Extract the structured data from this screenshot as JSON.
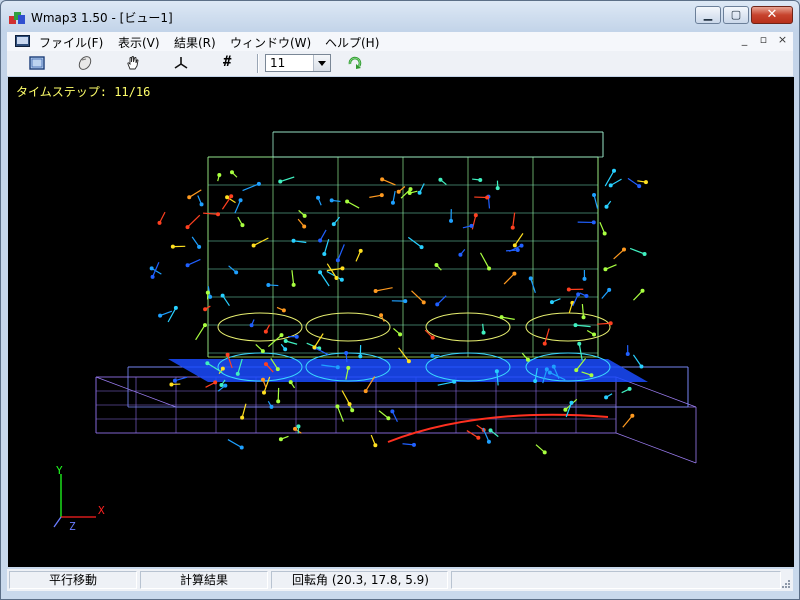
{
  "window": {
    "title": "Wmap3 1.50 - [ビュー1]",
    "caption_buttons": {
      "minimize": "▁",
      "maximize": "▢",
      "close": "✕"
    }
  },
  "menu": {
    "items": [
      "ファイル(F)",
      "表示(V)",
      "結果(R)",
      "ウィンドウ(W)",
      "ヘルプ(H)"
    ],
    "mdi_buttons": [
      "_",
      "▫",
      "×"
    ]
  },
  "toolbar": {
    "buttons": [
      "fit-view-icon",
      "rotate-icon",
      "hand-pan-icon",
      "axes-icon",
      "grid-hash-icon"
    ],
    "hash_glyph": "#",
    "step_value": "11",
    "run_button": "refresh-arrow-icon"
  },
  "viewport": {
    "timestep": "タイムステップ: 11/16",
    "axis": {
      "x": "X",
      "y": "Y",
      "z": "Z"
    },
    "colors": {
      "background": "#000000",
      "axis_x": "#ff2020",
      "axis_y": "#20ff20",
      "axis_z": "#6a7cff"
    }
  },
  "status": {
    "mode": "平行移動",
    "result": "計算結果",
    "rotation": "回転角 (20.3, 17.8, 5.9)",
    "empty": ""
  }
}
